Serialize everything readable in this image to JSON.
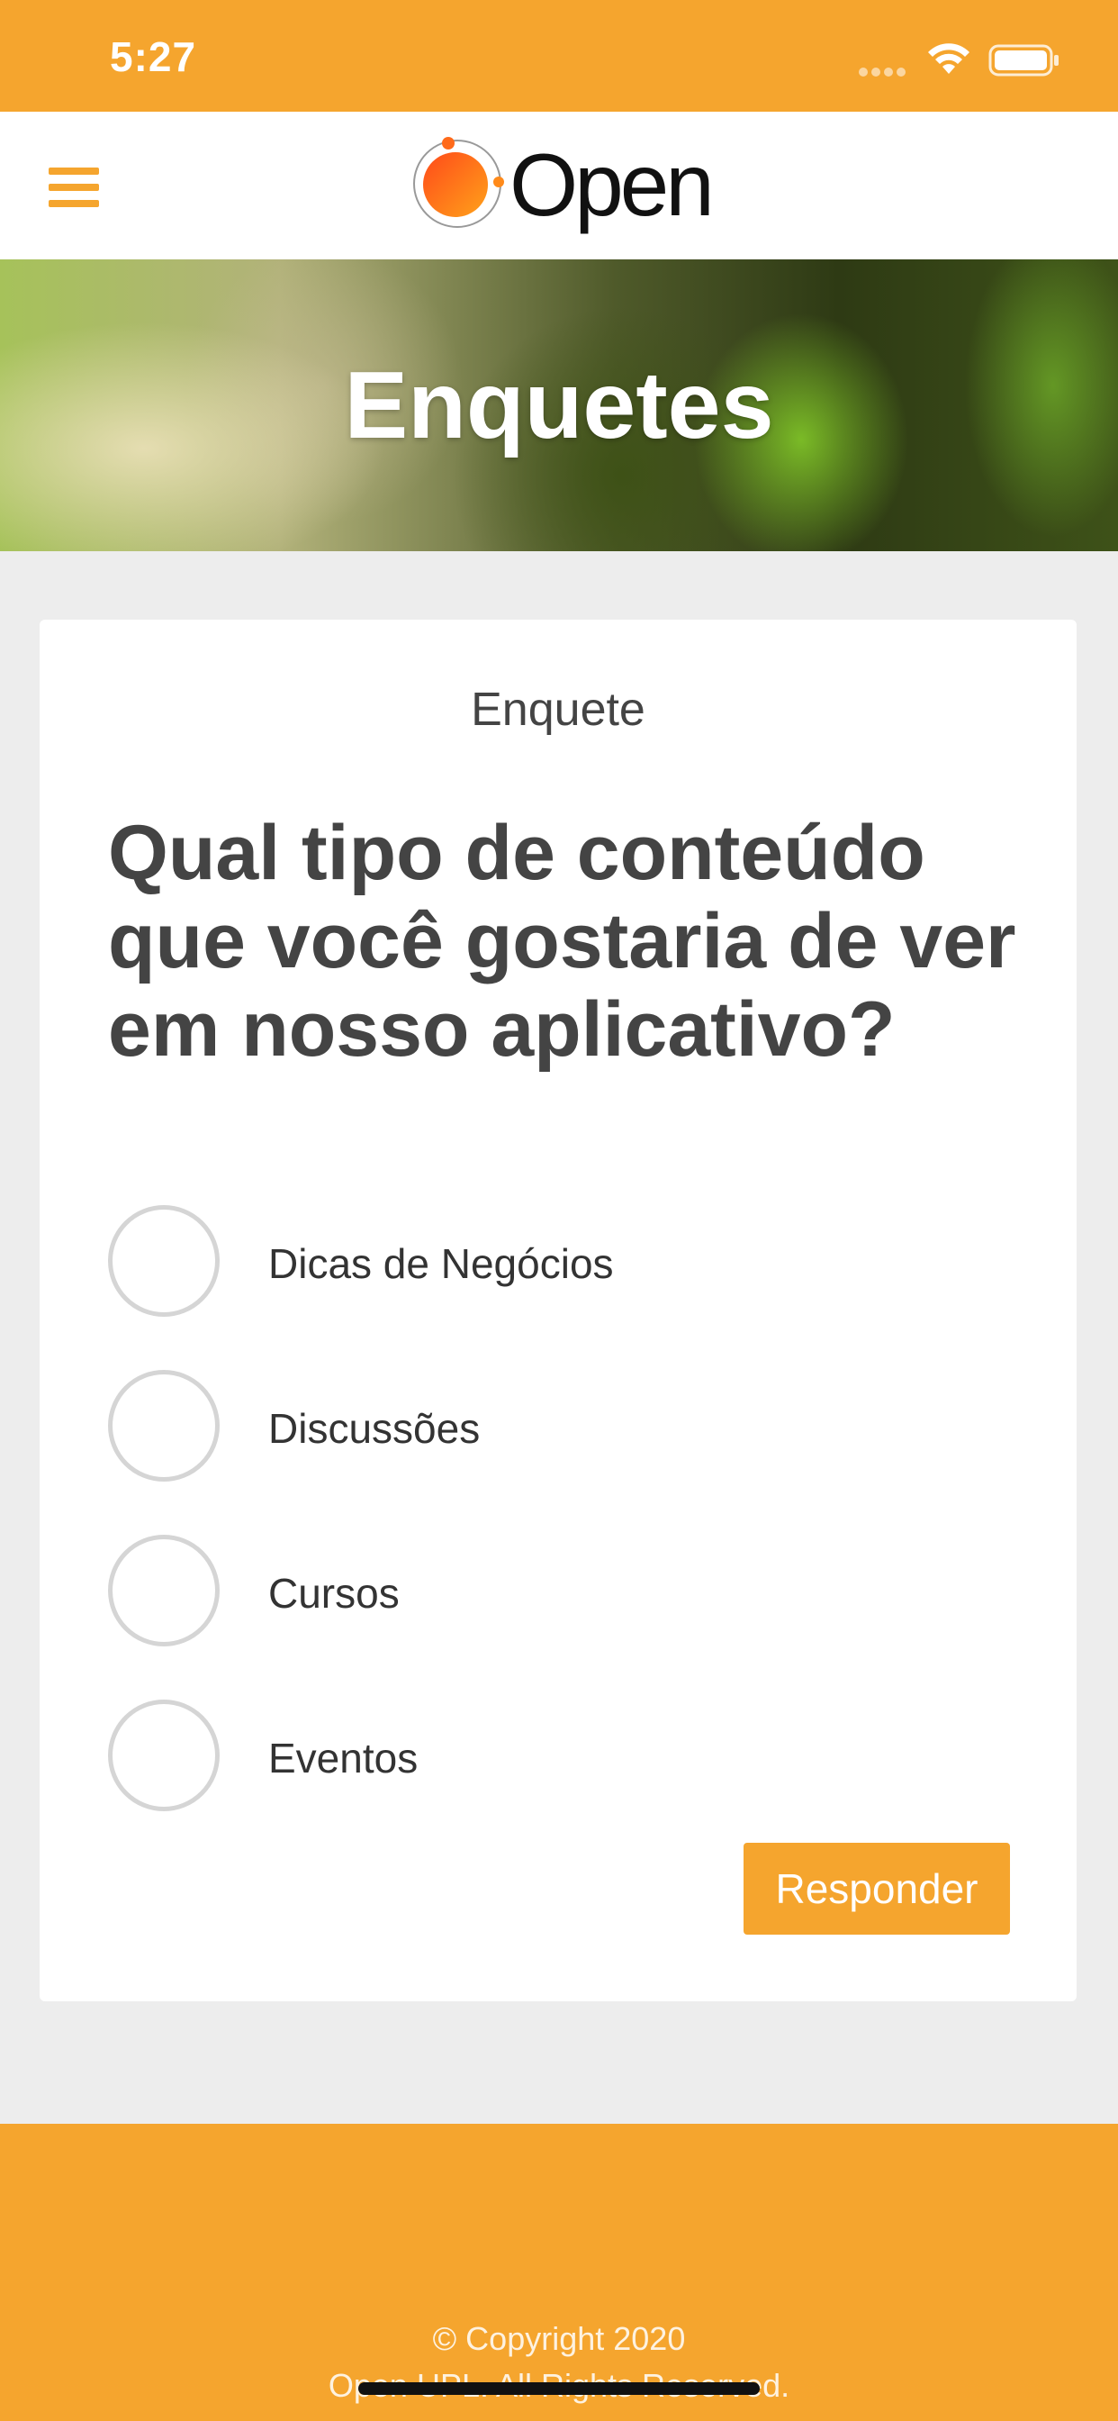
{
  "status_bar": {
    "time": "5:27",
    "icons": [
      "signal-icon",
      "wifi-icon",
      "battery-icon"
    ]
  },
  "header": {
    "logo_text": "Open",
    "menu_icon": "hamburger-menu-icon"
  },
  "hero": {
    "title": "Enquetes"
  },
  "poll": {
    "label": "Enquete",
    "question": "Qual tipo de conteúdo que você gostaria de ver em nosso aplicativo?",
    "options": [
      {
        "label": "Dicas de Negócios",
        "selected": false
      },
      {
        "label": "Discussões",
        "selected": false
      },
      {
        "label": "Cursos",
        "selected": false
      },
      {
        "label": "Eventos",
        "selected": false
      }
    ],
    "submit_label": "Responder"
  },
  "footer": {
    "copyright": "© Copyright 2020",
    "rights": "Open UPL. All Rights Reserved."
  },
  "colors": {
    "accent": "#f5a52e",
    "text_dark": "#444444",
    "background": "#ededed",
    "card": "#ffffff"
  }
}
